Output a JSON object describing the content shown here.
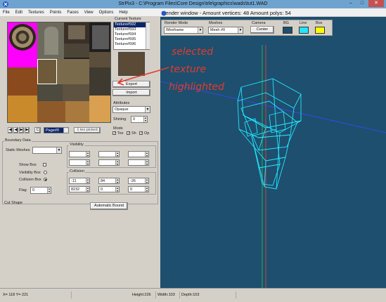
{
  "window": {
    "title": "StrPix3 - C:\\Program Files\\Core Design\\trle\\graphics\\wads\\tut1.WAD",
    "buttons": [
      "–",
      "□",
      "✕"
    ]
  },
  "menu": [
    "File",
    "Edit",
    "Textures",
    "Points",
    "Faces",
    "View",
    "Options",
    "Help"
  ],
  "left": {
    "current_texture_label": "Current Texture",
    "texture_list": [
      "Texture#592",
      "Texture#593",
      "Texture#594",
      "Texture#595",
      "Texture#596"
    ],
    "export_label": "Export",
    "import_label": "Import",
    "attributes_label": "Attributes",
    "attributes_value": "Opaque",
    "shining_label": "Shining",
    "shining_value": "0",
    "mode_label": "Mode",
    "mode_tex": "Tex",
    "mode_sh": "Sh",
    "mode_op": "Op",
    "page_value": "Page#0",
    "page_c": "C",
    "picked_label": "1 tex picked",
    "boundary_label": "Boundary Data",
    "static_meshes_label": "Static Meshes",
    "show_box": "Show Box",
    "visibility_box": "Visibility Box",
    "collision_box": "Collision Box",
    "flag_label": "Flag",
    "flag_value": "0",
    "visibility_label": "Visibility",
    "collision_label": "Collision",
    "collision_values": [
      "-11",
      "84",
      "-26",
      "8232",
      "0",
      "0"
    ],
    "cut_shape_label": "Cut Shape",
    "auto_bound_label": "Automatic Bound"
  },
  "render": {
    "title": "Render window - Amount vertices: 48   Amount polys: 54",
    "render_mode_label": "Render Mode",
    "render_mode_value": "Wireframe",
    "meshes_label": "Meshes",
    "meshes_value": "Mesh #0",
    "camera_label": "Camera",
    "center_label": "Center",
    "bg_label": "BG",
    "line_label": "Line",
    "box_label": "Box",
    "bg_color": "#1e4f6e",
    "line_color": "#22e6ff",
    "box_color": "#ffff00"
  },
  "annotation": {
    "lines": [
      "selected",
      "texture",
      "highlighted"
    ],
    "color": "#e23b2e"
  },
  "status": {
    "coords": "X= 118 Y= 221",
    "height": "Height:226",
    "width": "Width:103",
    "depth": "Depth:103"
  }
}
